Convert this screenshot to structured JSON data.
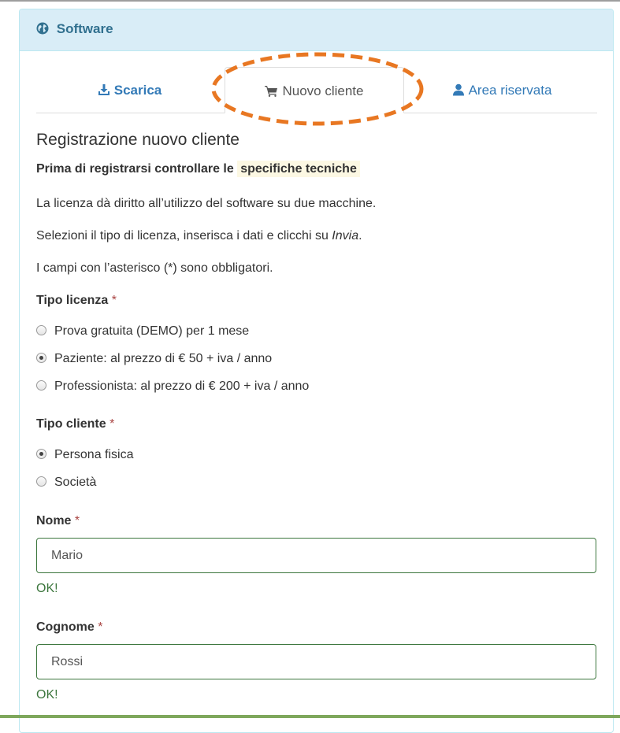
{
  "panel": {
    "title": "Software",
    "icon": "globe-icon"
  },
  "tabs": [
    {
      "label": "Scarica",
      "icon": "download-icon",
      "active": false
    },
    {
      "label": "Nuovo cliente",
      "icon": "cart-icon",
      "active": true
    },
    {
      "label": "Area riservata",
      "icon": "user-icon",
      "active": false
    }
  ],
  "form": {
    "heading": "Registrazione nuovo cliente",
    "check_prefix": "Prima di registrarsi controllare le",
    "check_link": "specifiche tecniche",
    "license_note": "La licenza dà diritto all’utilizzo del software su due macchine.",
    "instructions_prefix": "Selezioni il tipo di licenza, inserisca i dati e clicchi su",
    "instructions_em": "Invia",
    "instructions_suffix": ".",
    "required_note": "I campi con l’asterisco (*) sono obbligatori.",
    "required_mark": "*",
    "license_type": {
      "label": "Tipo licenza",
      "options": [
        {
          "label": "Prova gratuita (DEMO) per 1 mese",
          "checked": false
        },
        {
          "label": "Paziente: al prezzo di € 50 + iva / anno",
          "checked": true
        },
        {
          "label": "Professionista: al prezzo di € 200 + iva / anno",
          "checked": false
        }
      ]
    },
    "client_type": {
      "label": "Tipo cliente",
      "options": [
        {
          "label": "Persona fisica",
          "checked": true
        },
        {
          "label": "Società",
          "checked": false
        }
      ]
    },
    "nome": {
      "label": "Nome",
      "value": "Mario",
      "status": "OK!"
    },
    "cognome": {
      "label": "Cognome",
      "value": "Rossi",
      "status": "OK!"
    }
  },
  "colors": {
    "panel_heading_bg": "#d9edf7",
    "link_blue": "#337ab7",
    "success_green": "#3c763d",
    "highlight_orange": "#e87722"
  }
}
